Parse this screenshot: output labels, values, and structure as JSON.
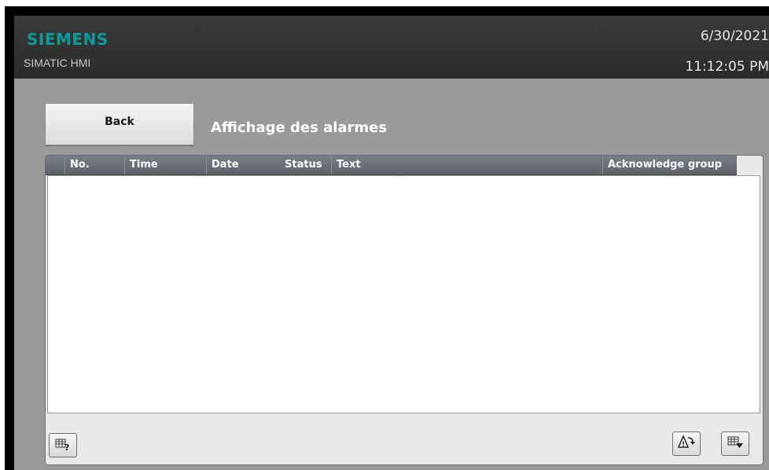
{
  "header": {
    "brand": "SIEMENS",
    "product": "SIMATIC HMI",
    "date": "6/30/2021",
    "time": "11:12:05 PM"
  },
  "screen": {
    "back_label": "Back",
    "title": "Affichage des alarmes"
  },
  "alarm_table": {
    "columns": [
      "No.",
      "Time",
      "Date",
      "Status",
      "Text",
      "Acknowledge group"
    ],
    "rows": []
  },
  "toolbar": {
    "left_buttons": [
      "info-tooltip-icon"
    ],
    "right_buttons": [
      "acknowledge-icon",
      "edit-loop-in-icon"
    ]
  },
  "colors": {
    "brand": "#0a9b9b",
    "header_bg": "#2b2b2b",
    "screen_bg": "#9a9a9a",
    "table_header_bg": "#6a6d73"
  }
}
